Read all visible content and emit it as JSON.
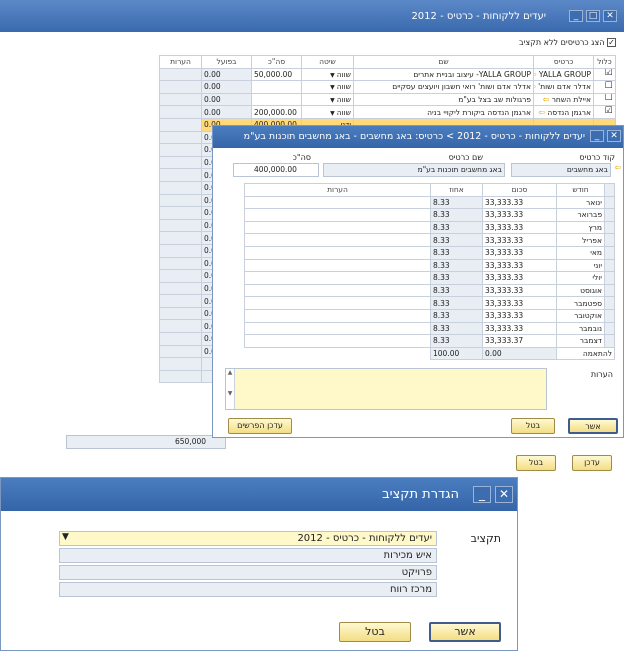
{
  "win1": {
    "title": "יעדים ללקוחות - כרטיס - 2012",
    "checkbox_label": "הצג כרטיסים ללא תקציב",
    "columns": [
      "כלול",
      "כרטיס",
      "שם",
      "שיטה",
      "סה\"כ",
      "בפועל",
      "הערות"
    ],
    "rows": [
      {
        "incl": "☑",
        "card": "YALLA GROUP",
        "name": "YALLA GROUP- עיצוב ובניית אתרים",
        "method": "שווה",
        "total": "50,000.00",
        "actual": "0.00"
      },
      {
        "incl": "☐",
        "card": "אדלר אדם ושות'",
        "name": "אדלר אדם ושות' רואי חשבון ויועצים עסקיים",
        "method": "שווה",
        "total": "",
        "actual": "0.00"
      },
      {
        "incl": "☐",
        "card": "איילת השחר",
        "name": "פרגולות שב בצל בע\"מ",
        "method": "שווה",
        "total": "",
        "actual": "0.00"
      },
      {
        "incl": "☑",
        "card": "ארגמן הנדסה",
        "name": "ארגמן הנדסה ביקורת ליקויי בניה",
        "method": "שווה",
        "total": "200,000.00",
        "actual": "0.00"
      },
      {
        "incl": "",
        "card": "",
        "name": "",
        "method": "ידני",
        "total": "400,000.00",
        "actual": "0.00"
      },
      {
        "incl": "",
        "card": "",
        "name": "",
        "method": "שווה",
        "total": "",
        "actual": "0.00"
      },
      {
        "incl": "",
        "card": "",
        "name": "",
        "method": "שווה",
        "total": "",
        "actual": "0.00"
      },
      {
        "incl": "",
        "card": "",
        "name": "",
        "method": "שווה",
        "total": "",
        "actual": "0.00"
      },
      {
        "incl": "",
        "card": "",
        "name": "",
        "method": "שווה",
        "total": "",
        "actual": "0.00"
      },
      {
        "incl": "",
        "card": "",
        "name": "",
        "method": "שווה",
        "total": "",
        "actual": "0.00"
      },
      {
        "incl": "",
        "card": "",
        "name": "",
        "method": "שווה",
        "total": "",
        "actual": "0.00"
      },
      {
        "incl": "",
        "card": "",
        "name": "",
        "method": "שווה",
        "total": "",
        "actual": "0.00"
      },
      {
        "incl": "",
        "card": "",
        "name": "",
        "method": "שווה",
        "total": "",
        "actual": "0.00"
      },
      {
        "incl": "",
        "card": "",
        "name": "",
        "method": "שווה",
        "total": "",
        "actual": "0.00"
      },
      {
        "incl": "",
        "card": "",
        "name": "",
        "method": "שווה",
        "total": "",
        "actual": "0.00"
      },
      {
        "incl": "",
        "card": "",
        "name": "",
        "method": "שווה",
        "total": "",
        "actual": "0.00"
      },
      {
        "incl": "",
        "card": "",
        "name": "",
        "method": "שווה",
        "total": "",
        "actual": "0.00"
      },
      {
        "incl": "",
        "card": "",
        "name": "",
        "method": "שווה",
        "total": "",
        "actual": "0.00"
      },
      {
        "incl": "",
        "card": "",
        "name": "",
        "method": "שווה",
        "total": "",
        "actual": "0.00"
      },
      {
        "incl": "",
        "card": "",
        "name": "",
        "method": "שווה",
        "total": "",
        "actual": "0.00"
      },
      {
        "incl": "",
        "card": "",
        "name": "",
        "method": "שווה",
        "total": "",
        "actual": "0.00"
      },
      {
        "incl": "",
        "card": "",
        "name": "",
        "method": "שווה",
        "total": "",
        "actual": "0.00"
      },
      {
        "incl": "",
        "card": "",
        "name": "",
        "method": "שווה",
        "total": "",
        "actual": "0.00"
      },
      {
        "incl": "",
        "card": "",
        "name": "",
        "method": "",
        "total": "",
        "actual": ""
      },
      {
        "incl": "",
        "card": "",
        "name": "",
        "method": "",
        "total": "",
        "actual": ""
      }
    ],
    "sum": "650,000",
    "update_btn": "עדכן",
    "cancel_btn": "בטל"
  },
  "win2": {
    "title": "יעדים ללקוחות - כרטיס - 2012 > כרטיס: באג מחשבים - באג מחשבים תוכנות בע\"מ",
    "lbl_card_code": "קוד כרטיס",
    "lbl_card_name": "שם כרטיס",
    "lbl_total": "סה\"כ",
    "card_code": "באג מחשבים",
    "card_name": "באג מחשבים תוכנות בע\"מ",
    "total": "400,000.00",
    "columns": [
      "חודש",
      "סכום",
      "אחוז",
      "הערות"
    ],
    "months": [
      {
        "m": "ינואר",
        "amt": "33,333.33",
        "pct": "8.33"
      },
      {
        "m": "פברואר",
        "amt": "33,333.33",
        "pct": "8.33"
      },
      {
        "m": "מרץ",
        "amt": "33,333.33",
        "pct": "8.33"
      },
      {
        "m": "אפריל",
        "amt": "33,333.33",
        "pct": "8.33"
      },
      {
        "m": "מאי",
        "amt": "33,333.33",
        "pct": "8.33"
      },
      {
        "m": "יוני",
        "amt": "33,333.33",
        "pct": "8.33"
      },
      {
        "m": "יולי",
        "amt": "33,333.33",
        "pct": "8.33"
      },
      {
        "m": "אוגוסט",
        "amt": "33,333.33",
        "pct": "8.33"
      },
      {
        "m": "ספטמבר",
        "amt": "33,333.33",
        "pct": "8.33"
      },
      {
        "m": "אוקטובר",
        "amt": "33,333.33",
        "pct": "8.33"
      },
      {
        "m": "נובמבר",
        "amt": "33,333.33",
        "pct": "8.33"
      },
      {
        "m": "דצמבר",
        "amt": "33,333.37",
        "pct": "8.33"
      }
    ],
    "match_label": "להתאמה",
    "match_amt": "0.00",
    "match_pct": "100.00",
    "notes_label": "הערות",
    "update_diff_btn": "עדכן הפרשים",
    "ok_btn": "אשר",
    "cancel_btn": "בטל"
  },
  "win3": {
    "title": "הגדרת תקציב",
    "lbl_budget": "תקציב",
    "budget_value": "יעדים ללקוחות - כרטיס - 2012",
    "fields": [
      "איש מכירות",
      "פרויקט",
      "מרכז רווח"
    ],
    "ok_btn": "אשר",
    "cancel_btn": "בטל"
  }
}
